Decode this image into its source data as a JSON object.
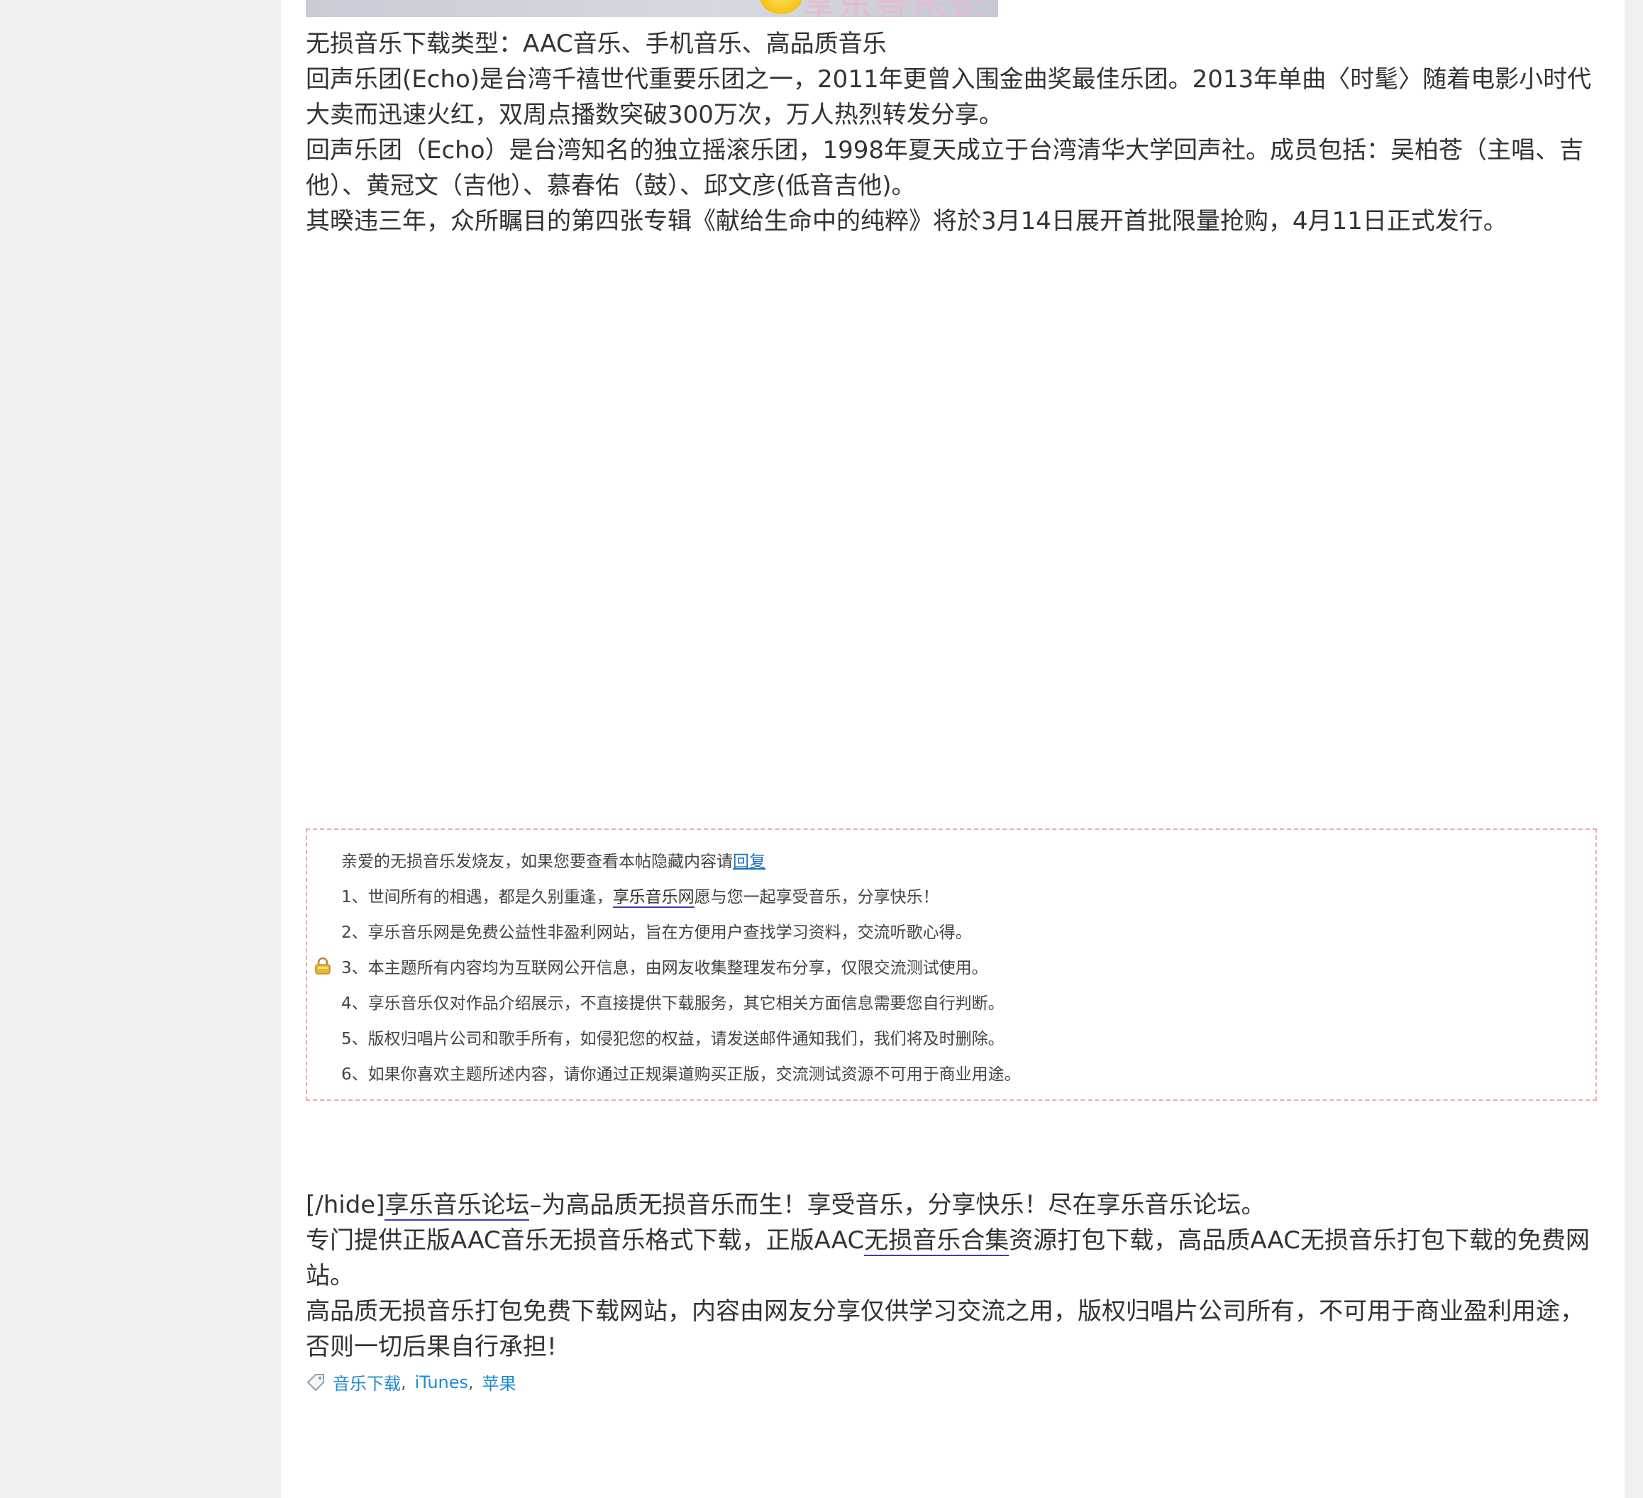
{
  "banner": {
    "text": "享乐音乐论坛"
  },
  "article": {
    "paragraphs": [
      "无损音乐下载类型：AAC音乐、手机音乐、高品质音乐",
      "回声乐团(Echo)是台湾千禧世代重要乐团之一，2011年更曾入围金曲奖最佳乐团。2013年单曲〈时髦〉随着电影小时代大卖而迅速火红，双周点播数突破300万次，万人热烈转发分享。",
      "回声乐团（Echo）是台湾知名的独立摇滚乐团，1998年夏天成立于台湾清华大学回声社。成员包括：吴柏苍（主唱、吉他）、黄冠文（吉他）、慕春佑（鼓）、邱文彦(低音吉他)。",
      "其暌违三年，众所瞩目的第四张专辑《献给生命中的纯粹》将於3月14日展开首批限量抢购，4月11日正式发行。"
    ]
  },
  "hidebox": {
    "intro": "亲爱的无损音乐发烧友，如果您要查看本帖隐藏内容请",
    "reply_link": "回复",
    "line1_pre": "1、世间所有的相遇，都是久别重逢，",
    "line1_link": "享乐音乐网",
    "line1_post": "愿与您一起享受音乐，分享快乐！",
    "line2": "2、享乐音乐网是免费公益性非盈利网站，旨在方便用户查找学习资料，交流听歌心得。",
    "line3": "3、本主题所有内容均为互联网公开信息，由网友收集整理发布分享，仅限交流测试使用。",
    "line4": "4、享乐音乐仅对作品介绍展示，不直接提供下载服务，其它相关方面信息需要您自行判断。",
    "line5": "5、版权归唱片公司和歌手所有，如侵犯您的权益，请发送邮件通知我们，我们将及时删除。",
    "line6": "6、如果你喜欢主题所述内容，请你通过正规渠道购买正版，交流测试资源不可用于商业用途。"
  },
  "footer": {
    "p1_pre": "[/hide]",
    "p1_link": "享乐音乐论坛",
    "p1_post": "–为高品质无损音乐而生！享受音乐，分享快乐！尽在享乐音乐论坛。",
    "p2_pre": "专门提供正版AAC音乐无损音乐格式下载，正版AAC",
    "p2_link": "无损音乐合集",
    "p2_post": "资源打包下载，高品质AAC无损音乐打包下载的免费网站。",
    "p3": "高品质无损音乐打包免费下载网站，内容由网友分享仅供学习交流之用，版权归唱片公司所有，不可用于商业盈利用途，否则一切后果自行承担!"
  },
  "tags": {
    "items": [
      "音乐下载",
      "iTunes",
      "苹果"
    ],
    "separator": ","
  },
  "colors": {
    "link": "#1f6fbd",
    "tag": "#1f8ad0",
    "box_border": "#f2a8a8"
  }
}
